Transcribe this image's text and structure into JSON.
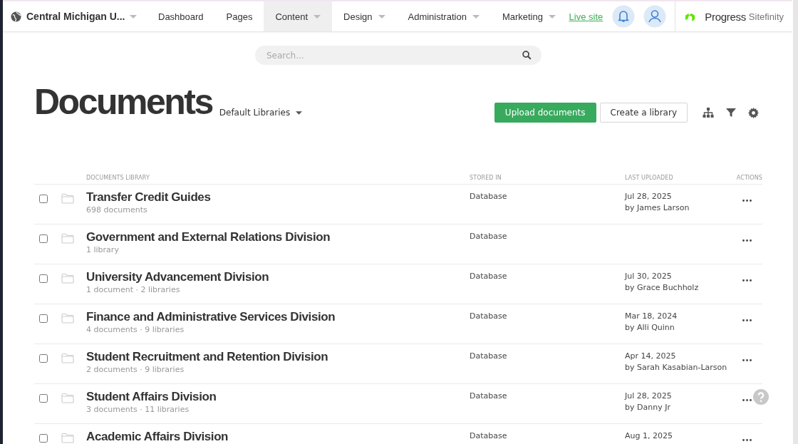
{
  "topbar": {
    "site_name": "Central Michigan U...",
    "nav": [
      {
        "label": "Dashboard",
        "selected": false,
        "dropdown": false
      },
      {
        "label": "Pages",
        "selected": false,
        "dropdown": false
      },
      {
        "label": "Content",
        "selected": true,
        "dropdown": true
      },
      {
        "label": "Design",
        "selected": false,
        "dropdown": true
      },
      {
        "label": "Administration",
        "selected": false,
        "dropdown": true
      },
      {
        "label": "Marketing",
        "selected": false,
        "dropdown": true
      }
    ],
    "live_site": "Live site",
    "brand": {
      "name": "Progress",
      "product": "Sitefinity"
    }
  },
  "search": {
    "placeholder": "Search..."
  },
  "header": {
    "title": "Documents",
    "library_selector": "Default Libraries",
    "buttons": [
      {
        "label": "Upload documents",
        "kind": "primary"
      },
      {
        "label": "Create a library",
        "kind": "secondary"
      }
    ]
  },
  "table": {
    "columns": [
      "DOCUMENTS LIBRARY",
      "STORED IN",
      "LAST UPLOADED",
      "ACTIONS"
    ],
    "rows": [
      {
        "title": "Transfer Credit Guides",
        "meta": "698 documents",
        "stored_in": "Database",
        "date": "Jul 28, 2025",
        "by": "by James Larson",
        "checked": false
      },
      {
        "title": "Government and External Relations Division",
        "meta": "1 library",
        "stored_in": "Database",
        "checked": false
      },
      {
        "title": "University Advancement Division",
        "meta": "1 document · 2 libraries",
        "stored_in": "Database",
        "date": "Jul 30, 2025",
        "by": "by Grace Buchholz",
        "checked": false
      },
      {
        "title": "Finance and Administrative Services Division",
        "meta": "4 documents · 9 libraries",
        "stored_in": "Database",
        "date": "Mar 18, 2024",
        "by": "by Alli Quinn",
        "checked": false
      },
      {
        "title": "Student Recruitment and Retention Division",
        "meta": "2 documents · 9 libraries",
        "stored_in": "Database",
        "date": "Apr 14, 2025",
        "by": "by Sarah Kasabian-Larson",
        "checked": false
      },
      {
        "title": "Student Affairs Division",
        "meta": "3 documents · 11 libraries",
        "stored_in": "Database",
        "date": "Jul 28, 2025",
        "by": "by Danny Jr",
        "checked": false
      },
      {
        "title": "Academic Affairs Division",
        "stored_in": "Database",
        "date": "Aug 1, 2025",
        "checked": false
      }
    ]
  }
}
